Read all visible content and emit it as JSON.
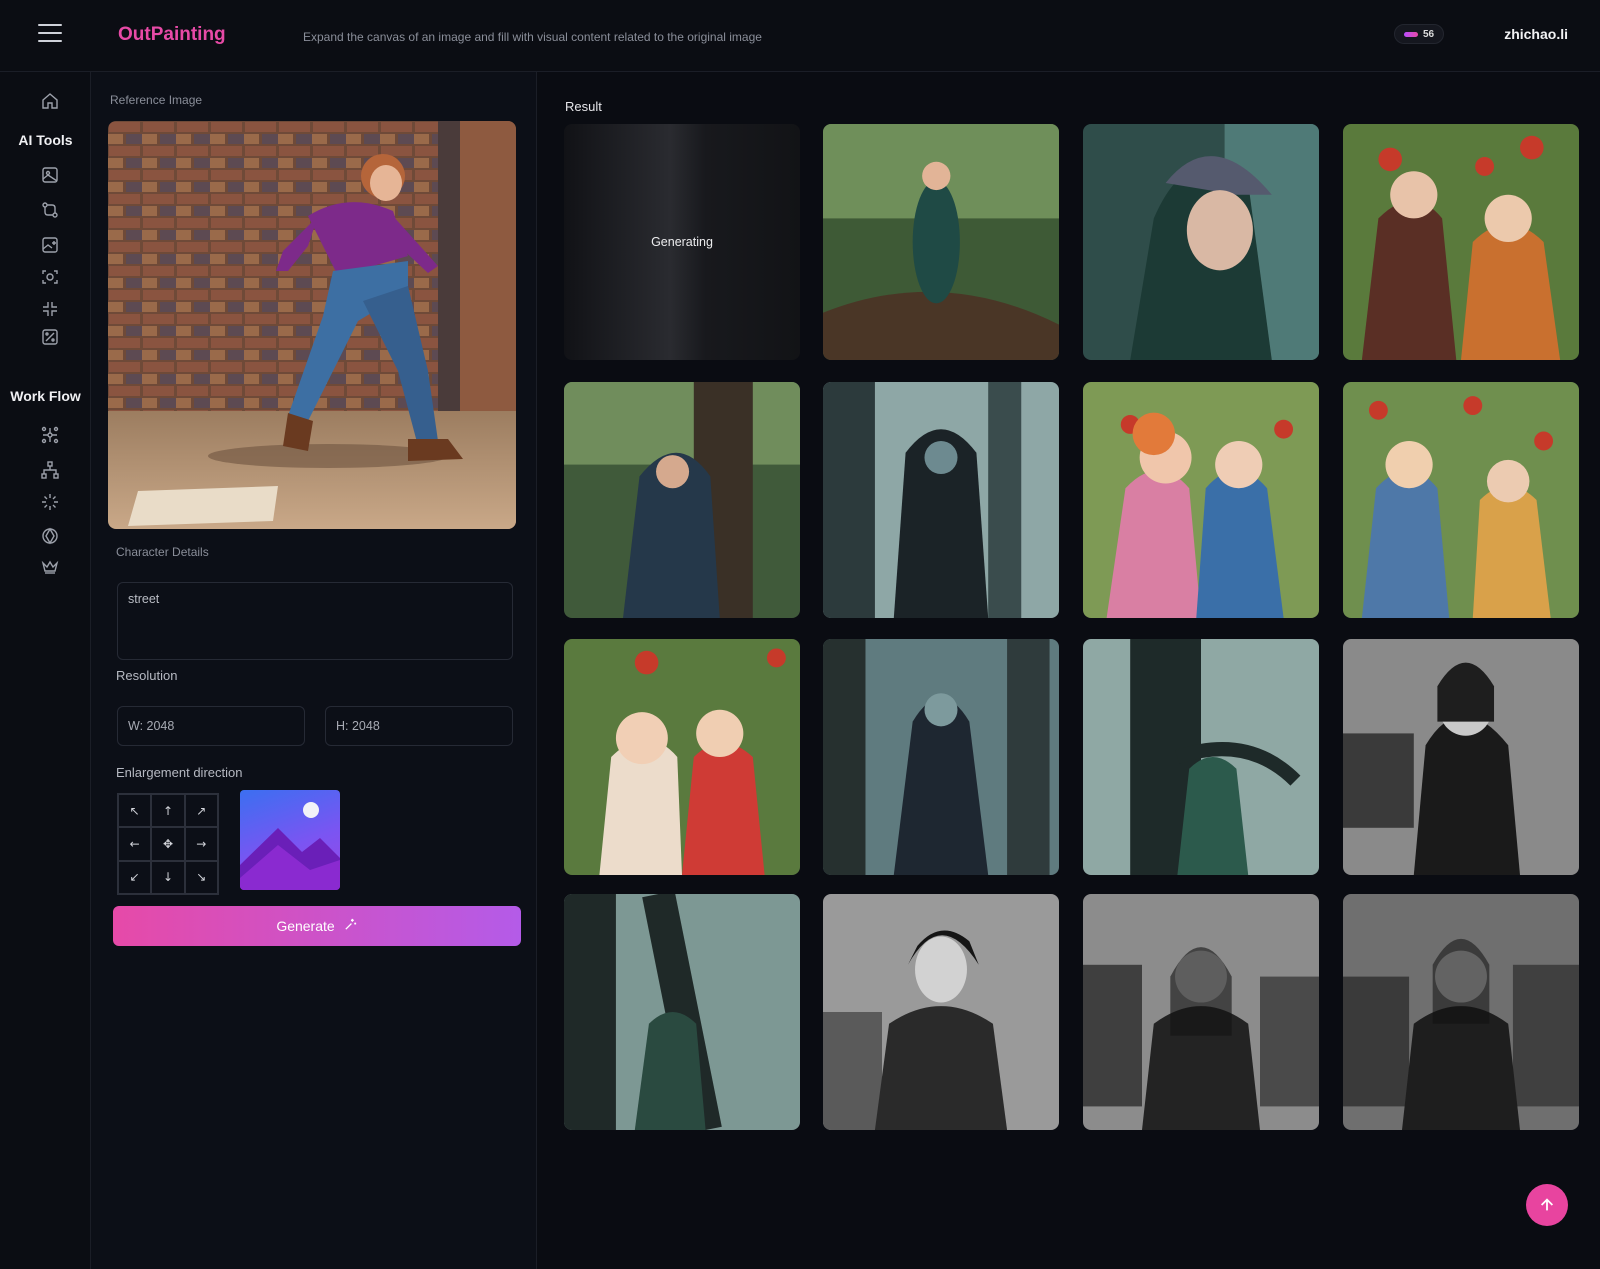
{
  "header": {
    "app_title": "OutPainting",
    "subtitle": "Expand the canvas of an image and fill with visual content related to the original image",
    "credits": "56",
    "username": "zhichao.li"
  },
  "sidenav": {
    "section_ai_tools": "AI Tools",
    "section_workflow": "Work Flow"
  },
  "panel": {
    "reference_label": "Reference Image",
    "character_label": "Character Details",
    "character_value": "street",
    "resolution_label": "Resolution",
    "width_value": "W: 2048",
    "height_value": "H: 2048",
    "direction_label": "Enlargement direction",
    "direction_arrows": [
      "↖",
      "↑",
      "↗",
      "←",
      "✥",
      "→",
      "↙",
      "↓",
      "↘"
    ],
    "generate_label": "Generate"
  },
  "results": {
    "title": "Result",
    "generating_label": "Generating"
  },
  "colors": {
    "accent_pink": "#e74aa6",
    "accent_purple": "#b45be8",
    "background": "#0b0d13"
  }
}
